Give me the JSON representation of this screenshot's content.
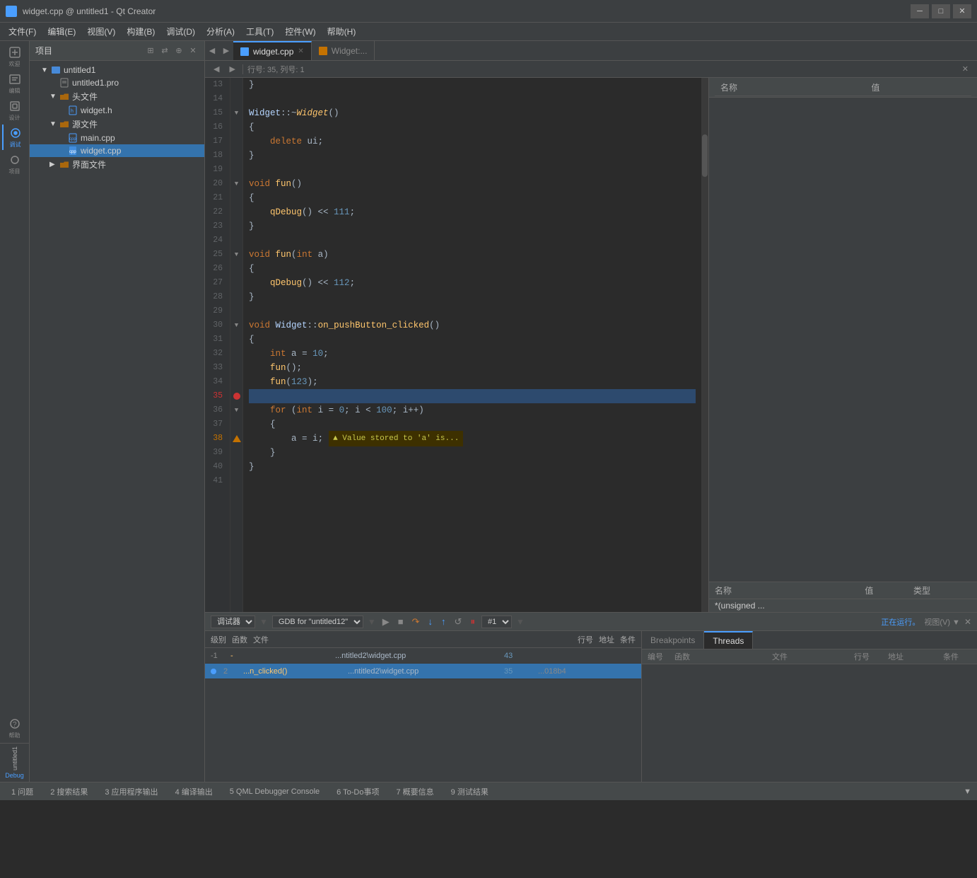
{
  "window": {
    "title": "widget.cpp @ untitled1 - Qt Creator",
    "icon": "qt-icon"
  },
  "menubar": {
    "items": [
      "文件(F)",
      "编辑(E)",
      "视图(V)",
      "构建(B)",
      "调试(D)",
      "分析(A)",
      "工具(T)",
      "控件(W)",
      "帮助(H)"
    ]
  },
  "sidebar": {
    "icons": [
      {
        "name": "welcome-icon",
        "label": "欢迎",
        "symbol": "⌂"
      },
      {
        "name": "edit-icon",
        "label": "编辑",
        "symbol": "✎"
      },
      {
        "name": "design-icon",
        "label": "设计",
        "symbol": "◈"
      },
      {
        "name": "debug-icon",
        "label": "调试",
        "symbol": "🐛"
      },
      {
        "name": "project-icon",
        "label": "项目",
        "symbol": "⚙"
      },
      {
        "name": "help-icon",
        "label": "帮助",
        "symbol": "?"
      }
    ]
  },
  "project_panel": {
    "title": "项目",
    "tree": [
      {
        "level": 1,
        "label": "untitled1",
        "type": "project",
        "arrow": "▼"
      },
      {
        "level": 2,
        "label": "untitled1.pro",
        "type": "file"
      },
      {
        "level": 2,
        "label": "头文件",
        "type": "folder",
        "arrow": "▼"
      },
      {
        "level": 3,
        "label": "widget.h",
        "type": "header"
      },
      {
        "level": 2,
        "label": "源文件",
        "type": "folder",
        "arrow": "▼"
      },
      {
        "level": 3,
        "label": "main.cpp",
        "type": "cpp"
      },
      {
        "level": 3,
        "label": "widget.cpp",
        "type": "cpp",
        "selected": true
      },
      {
        "level": 2,
        "label": "界面文件",
        "type": "folder",
        "arrow": "▶"
      }
    ]
  },
  "tabs": [
    {
      "label": "widget.cpp",
      "active": true,
      "closable": true
    },
    {
      "label": "Widget:...",
      "active": false
    }
  ],
  "editor_toolbar": {
    "line_col": "行号: 35, 列号: 1"
  },
  "watch_panel": {
    "title": "名称",
    "col1": "名称",
    "col2": "值",
    "col3": "类型",
    "locals_col1": "名称",
    "locals_col2": "值",
    "locals_col3": "类型",
    "locals_item": "*(unsigned ..."
  },
  "code": {
    "lines": [
      {
        "num": 13,
        "content": "}",
        "indent": 1,
        "fold": false
      },
      {
        "num": 14,
        "content": "",
        "indent": 0
      },
      {
        "num": 15,
        "content": "Widget::~Widget()",
        "indent": 0,
        "fold": true
      },
      {
        "num": 16,
        "content": "{",
        "indent": 0
      },
      {
        "num": 17,
        "content": "    delete ui;",
        "indent": 1
      },
      {
        "num": 18,
        "content": "}",
        "indent": 0
      },
      {
        "num": 19,
        "content": "",
        "indent": 0
      },
      {
        "num": 20,
        "content": "void fun()",
        "indent": 0,
        "fold": true
      },
      {
        "num": 21,
        "content": "{",
        "indent": 0
      },
      {
        "num": 22,
        "content": "    qDebug() << 111;",
        "indent": 1
      },
      {
        "num": 23,
        "content": "}",
        "indent": 0
      },
      {
        "num": 24,
        "content": "",
        "indent": 0
      },
      {
        "num": 25,
        "content": "void fun(int a)",
        "indent": 0,
        "fold": true
      },
      {
        "num": 26,
        "content": "{",
        "indent": 0
      },
      {
        "num": 27,
        "content": "    qDebug() << 112;",
        "indent": 1
      },
      {
        "num": 28,
        "content": "}",
        "indent": 0
      },
      {
        "num": 29,
        "content": "",
        "indent": 0
      },
      {
        "num": 30,
        "content": "void Widget::on_pushButton_clicked()",
        "indent": 0,
        "fold": true
      },
      {
        "num": 31,
        "content": "{",
        "indent": 0
      },
      {
        "num": 32,
        "content": "    int a = 10;",
        "indent": 1
      },
      {
        "num": 33,
        "content": "    fun();",
        "indent": 1
      },
      {
        "num": 34,
        "content": "    fun(123);",
        "indent": 1
      },
      {
        "num": 35,
        "content": "",
        "indent": 0,
        "breakpoint": true,
        "current": true
      },
      {
        "num": 36,
        "content": "    for (int i = 0; i < 100; i++)",
        "indent": 1,
        "fold": true
      },
      {
        "num": 37,
        "content": "    {",
        "indent": 1
      },
      {
        "num": 38,
        "content": "        a = i;",
        "indent": 2,
        "warning": true,
        "warning_text": "▲ Value stored to 'a' is..."
      },
      {
        "num": 39,
        "content": "    }",
        "indent": 1
      },
      {
        "num": 40,
        "content": "}",
        "indent": 0
      },
      {
        "num": 41,
        "content": "",
        "indent": 0
      }
    ]
  },
  "bottom_toolbar": {
    "debugger_label": "调试器",
    "gdb_label": "GDB for \"untitled12\"",
    "status": "正在运行。",
    "view_label": "视图(V)",
    "thread_label": "#1"
  },
  "stack": {
    "headers": [
      "级别",
      "函数",
      "文件",
      "行号",
      "地址"
    ],
    "rows": [
      {
        "num": "-1",
        "fn": "-",
        "file": "...ntitled2\\widget.cpp",
        "line": "43",
        "addr": "",
        "active": false
      },
      {
        "num": "2",
        "fn": "...n_clicked()",
        "file": "...ntitled2\\widget.cpp",
        "line": "35",
        "addr": "...018b4",
        "active": true
      }
    ]
  },
  "callstack_tabs": [
    "Breakpoints",
    "Threads"
  ],
  "callstack": {
    "col_num": "编号",
    "col_fn": "函数",
    "col_file": "文件",
    "col_line": "行号",
    "col_addr": "地址",
    "col_cond": "条件"
  },
  "statusbar": {
    "items": [
      "1 问题",
      "2 搜索结果",
      "3 应用程序输出",
      "4 编译输出",
      "5 QML Debugger Console",
      "6 To-Do事项",
      "7 概要信息",
      "9 测试结果"
    ],
    "right_icon": "▼"
  },
  "sidebar_bottom": {
    "label": "untitled1",
    "sublabel": "Debug"
  }
}
